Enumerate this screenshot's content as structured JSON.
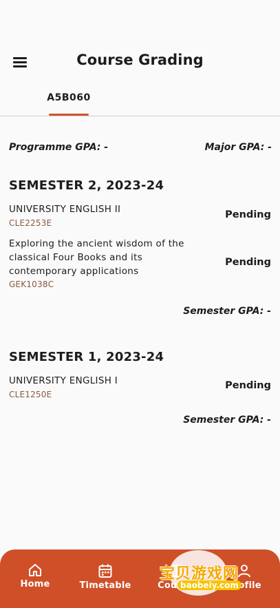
{
  "header": {
    "title": "Course Grading"
  },
  "tabs": [
    {
      "label": "A5B060",
      "active": true
    }
  ],
  "summary": {
    "programme_gpa": "Programme GPA: -",
    "major_gpa": "Major GPA: -"
  },
  "semesters": [
    {
      "title": "SEMESTER 2, 2023-24",
      "courses": [
        {
          "name": "UNIVERSITY ENGLISH II",
          "code": "CLE2253E",
          "status": "Pending"
        },
        {
          "name_lines": [
            "Exploring the ancient wisdom of the",
            "classical Four Books and its",
            "contemporary applications"
          ],
          "code": "GEK1038C",
          "status": "Pending"
        }
      ],
      "gpa": "Semester GPA: -"
    },
    {
      "title": "SEMESTER 1, 2023-24",
      "courses": [
        {
          "name": "UNIVERSITY ENGLISH I",
          "code": "CLE1250E",
          "status": "Pending"
        }
      ],
      "gpa": "Semester GPA: -"
    }
  ],
  "bottom_nav": {
    "items": [
      {
        "label": "Home",
        "icon": "home-icon"
      },
      {
        "label": "Timetable",
        "icon": "calendar-icon"
      },
      {
        "label": "Courses",
        "icon": "book-icon"
      },
      {
        "label": "Profile",
        "icon": "person-icon"
      }
    ]
  },
  "watermark": {
    "text": "宝贝游戏网",
    "url": "baobeiy.com"
  },
  "colors": {
    "accent": "#cf4f28",
    "code_text": "#8a5a40",
    "background": "#fafafa"
  }
}
